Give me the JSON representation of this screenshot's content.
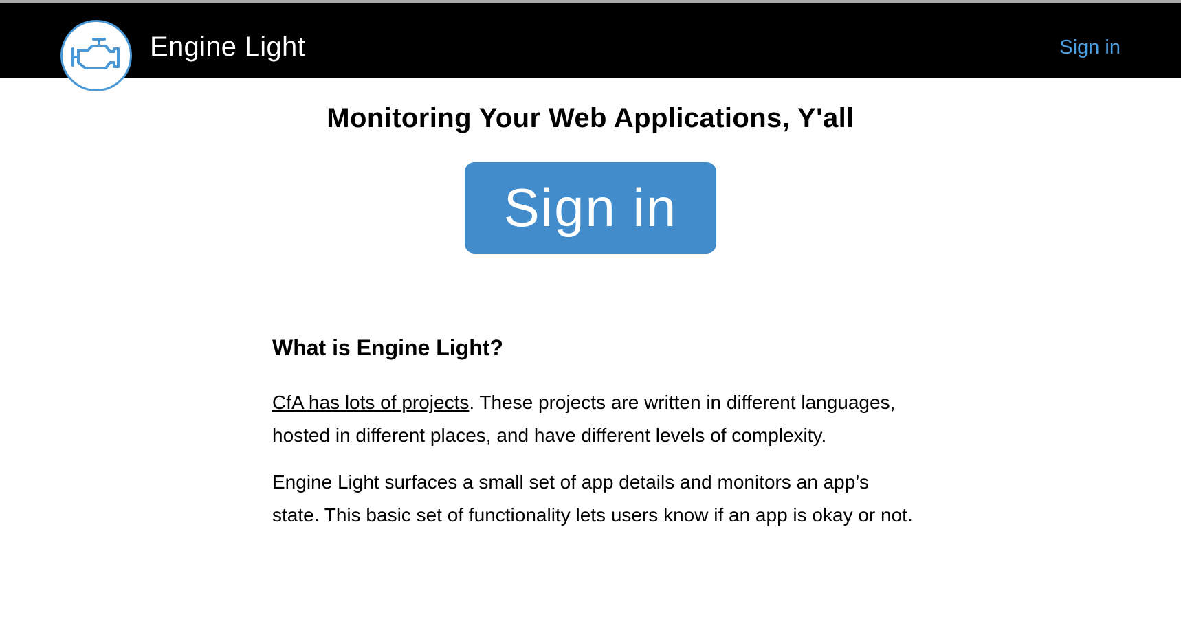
{
  "header": {
    "brand_title": "Engine Light",
    "logo_icon": "engine-icon",
    "nav_signin_label": "Sign in",
    "colors": {
      "bar": "#000000",
      "link": "#4a9ee0",
      "logo_ring": "#4a98d6"
    }
  },
  "hero": {
    "title": "Monitoring Your Web Applications, Y'all",
    "button_label": "Sign in",
    "button_color": "#428ccc"
  },
  "about": {
    "heading": "What is Engine Light?",
    "p1_link": "CfA has lots of projects",
    "p1_rest": ". These projects are written in different languages, hosted in different places, and have different levels of complexity.",
    "p2": "Engine Light surfaces a small set of app details and monitors an app’s state. This basic set of functionality lets users know if an app is okay or not."
  }
}
